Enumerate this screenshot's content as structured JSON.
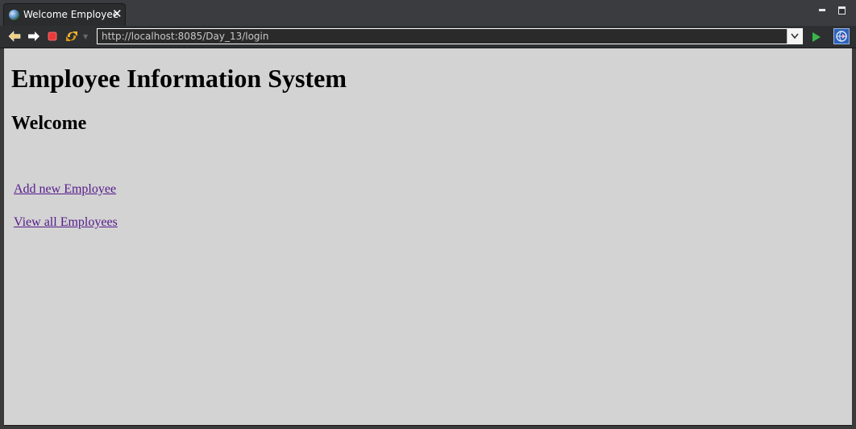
{
  "tab": {
    "title": "Welcome Employee",
    "icon": "globe-icon",
    "close_icon": "close-icon"
  },
  "window_controls": {
    "minimize_icon": "minimize-icon",
    "maximize_icon": "maximize-icon"
  },
  "toolbar": {
    "back_icon": "back-arrow-icon",
    "forward_icon": "forward-arrow-icon",
    "stop_icon": "stop-icon",
    "refresh_icon": "refresh-icon",
    "go_icon": "go-icon",
    "url": "http://localhost:8085/Day_13/login"
  },
  "page": {
    "heading": "Employee Information System",
    "subheading": "Welcome",
    "links": {
      "add": "Add new Employee",
      "view": "View all Employees"
    }
  },
  "colors": {
    "content_background": "#d3d3d3",
    "visited_link": "#551a8b",
    "chrome_dark": "#2f3033"
  }
}
